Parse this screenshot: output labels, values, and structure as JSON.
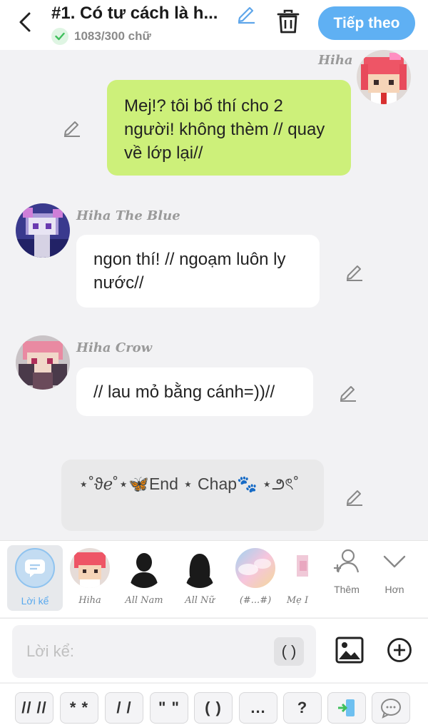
{
  "header": {
    "title": "#1. Có tư cách là h...",
    "word_count": "1083/300 chữ",
    "next_label": "Tiếp theo",
    "accent_color": "#5fb0f3"
  },
  "messages": [
    {
      "speaker": "Hiha",
      "text": "Mej!? tôi bố thí cho 2 người! không thèm // quay về lớp lại//",
      "side": "right",
      "bubble_color": "#cdf07a"
    },
    {
      "speaker": "Hiha The Blue",
      "text": "ngon thí! // ngoạm luôn ly nước//",
      "side": "left",
      "bubble_color": "#ffffff"
    },
    {
      "speaker": "Hiha Crow",
      "text": "// lau mỏ bằng cánh=))//",
      "side": "left",
      "bubble_color": "#ffffff"
    },
    {
      "speaker": "",
      "text": "⋆˚ϑℯ˚⋆🦋End ⋆ Chap🐾 ⋆౨ৎ˚",
      "side": "narration",
      "bubble_color": "#e9e9ea"
    }
  ],
  "characters": {
    "narration_label": "Lời kể",
    "items": [
      {
        "label": "Hiha",
        "icon": "avatar-pink-hair"
      },
      {
        "label": "All Nam",
        "icon": "male-silhouette"
      },
      {
        "label": "All Nữ",
        "icon": "female-silhouette"
      },
      {
        "label": "(#...#)",
        "icon": "pastel-clouds-avatar"
      },
      {
        "label": "Mẹ I",
        "icon": "avatar-partial"
      }
    ],
    "more_label": "Thêm",
    "expand_label": "Hơn"
  },
  "input": {
    "placeholder": "Lời kể:",
    "paren_label": "( )"
  },
  "quick_buttons": [
    "// //",
    "* *",
    "/ /",
    "\" \"",
    "( )",
    "...",
    "?",
    "",
    ""
  ]
}
